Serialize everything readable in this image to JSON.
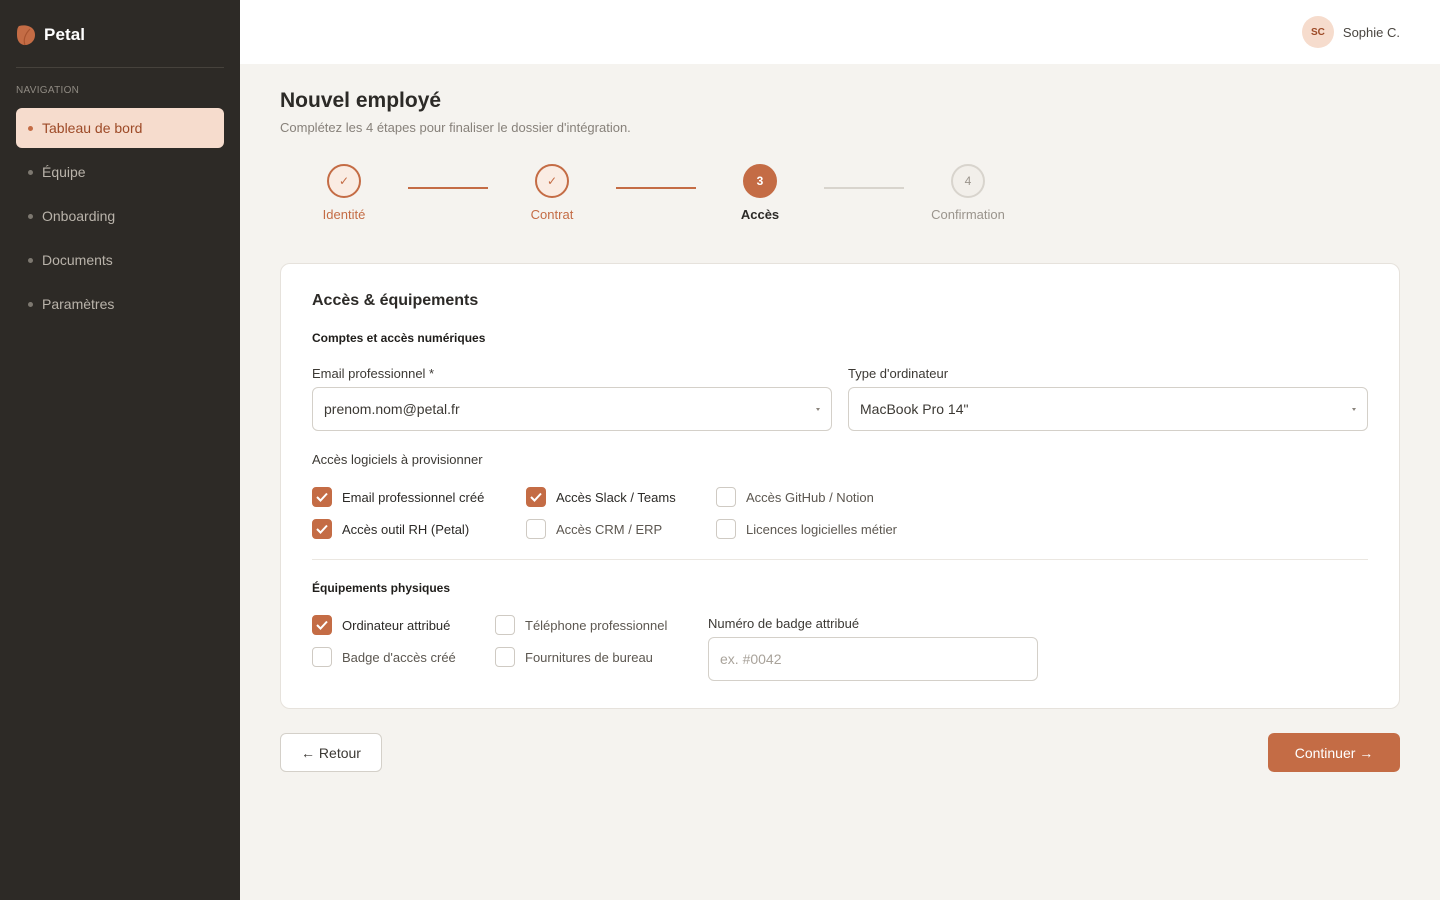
{
  "brand": {
    "name": "Petal",
    "logo_icon": "petal-logo-icon",
    "accent": "#c46c45"
  },
  "sidebar": {
    "heading": "NAVIGATION",
    "items": [
      {
        "label": "Tableau de bord",
        "active": true
      },
      {
        "label": "Équipe",
        "active": false
      },
      {
        "label": "Onboarding",
        "active": false
      },
      {
        "label": "Documents",
        "active": false
      },
      {
        "label": "Paramètres",
        "active": false
      }
    ]
  },
  "user": {
    "initials": "SC",
    "name": "Sophie C."
  },
  "page": {
    "title": "Nouvel employé",
    "subtitle": "Complétez les 4 étapes pour finaliser le dossier d'intégration."
  },
  "stepper": {
    "steps": [
      {
        "label": "Identité",
        "marker": "✓",
        "status": "done"
      },
      {
        "label": "Contrat",
        "marker": "✓",
        "status": "done"
      },
      {
        "label": "Accès",
        "marker": "3",
        "status": "current"
      },
      {
        "label": "Confirmation",
        "marker": "4",
        "status": "todo"
      }
    ]
  },
  "card": {
    "title": "Accès & équipements",
    "digital_section": {
      "title": "Comptes et accès numériques",
      "email": {
        "label": "Email professionnel *",
        "value": "prenom.nom@petal.fr"
      },
      "computer": {
        "label": "Type d'ordinateur",
        "value": "MacBook Pro 14\""
      },
      "software_label": "Accès logiciels à provisionner",
      "software": [
        {
          "label": "Email professionnel créé",
          "checked": true
        },
        {
          "label": "Accès outil RH (Petal)",
          "checked": true
        },
        {
          "label": "Accès Slack / Teams",
          "checked": true
        },
        {
          "label": "Accès CRM / ERP",
          "checked": false
        },
        {
          "label": "Accès GitHub / Notion",
          "checked": false
        },
        {
          "label": "Licences logicielles métier",
          "checked": false
        }
      ]
    },
    "physical_section": {
      "title": "Équipements physiques",
      "equipment": [
        {
          "label": "Ordinateur attribué",
          "checked": true
        },
        {
          "label": "Badge d'accès créé",
          "checked": false
        },
        {
          "label": "Téléphone professionnel",
          "checked": false
        },
        {
          "label": "Fournitures de bureau",
          "checked": false
        }
      ],
      "badge": {
        "label": "Numéro de badge attribué",
        "placeholder": "ex. #0042",
        "value": ""
      }
    }
  },
  "actions": {
    "back_label": "← Retour",
    "next_label": "Continuer →"
  }
}
